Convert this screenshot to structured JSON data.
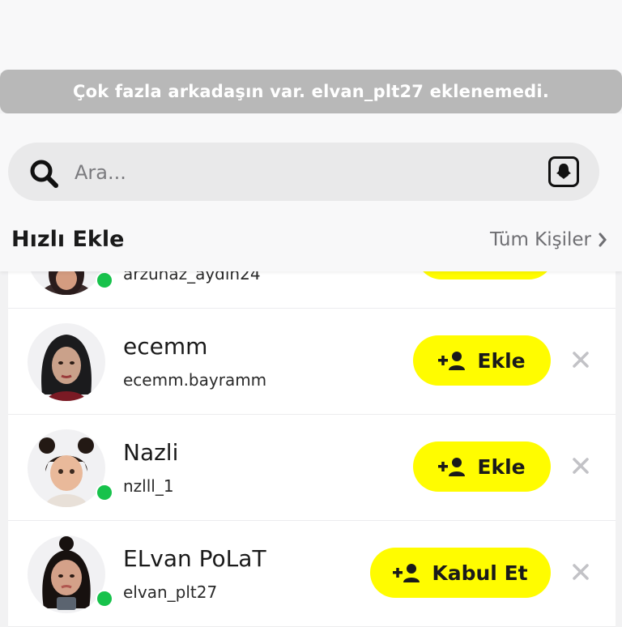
{
  "toast": {
    "message": "Çok fazla arkadaşın var. elvan_plt27 eklenemedi."
  },
  "search": {
    "placeholder": "Ara..."
  },
  "quick_add": {
    "title": "Hızlı Ekle",
    "all_contacts_label": "Tüm Kişiler"
  },
  "rows": [
    {
      "name": "",
      "username": "arzunaz_aydin24",
      "button_label": "",
      "online": true
    },
    {
      "name": "ecemm",
      "username": "ecemm.bayramm",
      "button_label": "Ekle",
      "online": false
    },
    {
      "name": "Nazli",
      "username": "nzlll_1",
      "button_label": "Ekle",
      "online": true
    },
    {
      "name": "ELvan PoLaT",
      "username": "elvan_plt27",
      "button_label": "Kabul Et",
      "online": true
    }
  ],
  "colors": {
    "accent_yellow": "#fffc00",
    "online_green": "#17c24b",
    "toast_gray": "#b8b8b8"
  },
  "icons": [
    "search-icon",
    "ghost-icon",
    "chevron-right-icon",
    "add-friend-icon",
    "close-icon"
  ]
}
